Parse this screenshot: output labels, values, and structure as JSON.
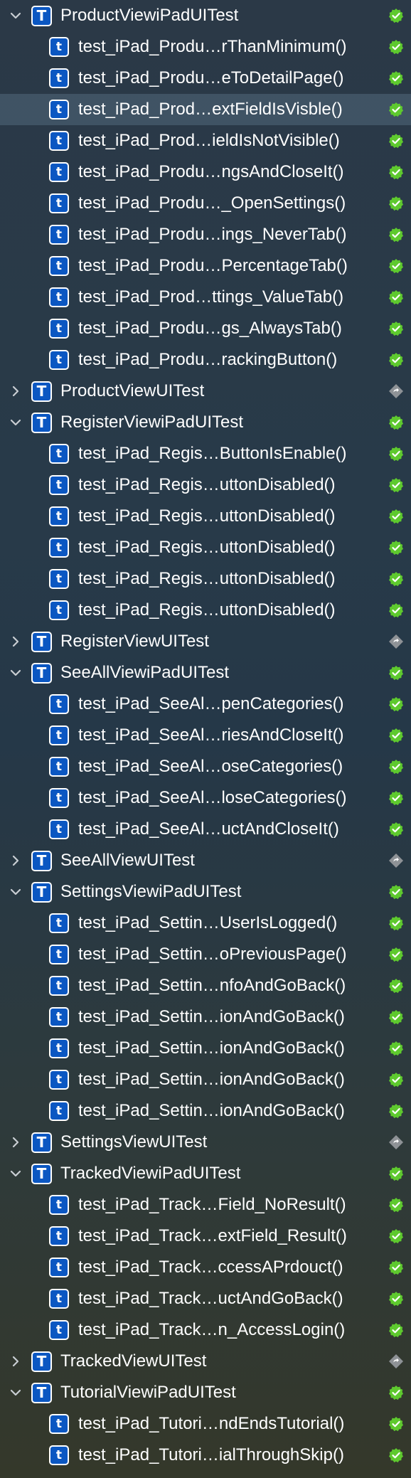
{
  "suites": [
    {
      "name": "ProductViewiPadUITest",
      "expanded": true,
      "status": "passed",
      "tests": [
        {
          "name": "test_iPad_Produ…rThanMinimum()",
          "status": "passed"
        },
        {
          "name": "test_iPad_Produ…eToDetailPage()",
          "status": "passed"
        },
        {
          "name": "test_iPad_Prod…extFieldIsVisble()",
          "status": "passed",
          "selected": true
        },
        {
          "name": "test_iPad_Prod…ieldIsNotVisible()",
          "status": "passed"
        },
        {
          "name": "test_iPad_Produ…ngsAndCloseIt()",
          "status": "passed"
        },
        {
          "name": "test_iPad_Produ…_OpenSettings()",
          "status": "passed"
        },
        {
          "name": "test_iPad_Produ…ings_NeverTab()",
          "status": "passed"
        },
        {
          "name": "test_iPad_Produ…PercentageTab()",
          "status": "passed"
        },
        {
          "name": "test_iPad_Prod…ttings_ValueTab()",
          "status": "passed"
        },
        {
          "name": "test_iPad_Produ…gs_AlwaysTab()",
          "status": "passed"
        },
        {
          "name": "test_iPad_Produ…rackingButton()",
          "status": "passed"
        }
      ]
    },
    {
      "name": "ProductViewUITest",
      "expanded": false,
      "status": "skipped",
      "tests": []
    },
    {
      "name": "RegisterViewiPadUITest",
      "expanded": true,
      "status": "passed",
      "tests": [
        {
          "name": "test_iPad_Regis…ButtonIsEnable()",
          "status": "passed"
        },
        {
          "name": "test_iPad_Regis…uttonDisabled()",
          "status": "passed"
        },
        {
          "name": "test_iPad_Regis…uttonDisabled()",
          "status": "passed"
        },
        {
          "name": "test_iPad_Regis…uttonDisabled()",
          "status": "passed"
        },
        {
          "name": "test_iPad_Regis…uttonDisabled()",
          "status": "passed"
        },
        {
          "name": "test_iPad_Regis…uttonDisabled()",
          "status": "passed"
        }
      ]
    },
    {
      "name": "RegisterViewUITest",
      "expanded": false,
      "status": "skipped",
      "tests": []
    },
    {
      "name": "SeeAllViewiPadUITest",
      "expanded": true,
      "status": "passed",
      "tests": [
        {
          "name": "test_iPad_SeeAl…penCategories()",
          "status": "passed"
        },
        {
          "name": "test_iPad_SeeAl…riesAndCloseIt()",
          "status": "passed"
        },
        {
          "name": "test_iPad_SeeAl…oseCategories()",
          "status": "passed"
        },
        {
          "name": "test_iPad_SeeAl…loseCategories()",
          "status": "passed"
        },
        {
          "name": "test_iPad_SeeAl…uctAndCloseIt()",
          "status": "passed"
        }
      ]
    },
    {
      "name": "SeeAllViewUITest",
      "expanded": false,
      "status": "skipped",
      "tests": []
    },
    {
      "name": "SettingsViewiPadUITest",
      "expanded": true,
      "status": "passed",
      "tests": [
        {
          "name": "test_iPad_Settin…UserIsLogged()",
          "status": "passed"
        },
        {
          "name": "test_iPad_Settin…oPreviousPage()",
          "status": "passed"
        },
        {
          "name": "test_iPad_Settin…nfoAndGoBack()",
          "status": "passed"
        },
        {
          "name": "test_iPad_Settin…ionAndGoBack()",
          "status": "passed"
        },
        {
          "name": "test_iPad_Settin…ionAndGoBack()",
          "status": "passed"
        },
        {
          "name": "test_iPad_Settin…ionAndGoBack()",
          "status": "passed"
        },
        {
          "name": "test_iPad_Settin…ionAndGoBack()",
          "status": "passed"
        }
      ]
    },
    {
      "name": "SettingsViewUITest",
      "expanded": false,
      "status": "skipped",
      "tests": []
    },
    {
      "name": "TrackedViewiPadUITest",
      "expanded": true,
      "status": "passed",
      "tests": [
        {
          "name": "test_iPad_Track…Field_NoResult()",
          "status": "passed"
        },
        {
          "name": "test_iPad_Track…extField_Result()",
          "status": "passed"
        },
        {
          "name": "test_iPad_Track…ccessAPrdouct()",
          "status": "passed"
        },
        {
          "name": "test_iPad_Track…uctAndGoBack()",
          "status": "passed"
        },
        {
          "name": "test_iPad_Track…n_AccessLogin()",
          "status": "passed"
        }
      ]
    },
    {
      "name": "TrackedViewUITest",
      "expanded": false,
      "status": "skipped",
      "tests": []
    },
    {
      "name": "TutorialViewiPadUITest",
      "expanded": true,
      "status": "passed",
      "tests": [
        {
          "name": "test_iPad_Tutori…ndEndsTutorial()",
          "status": "passed"
        },
        {
          "name": "test_iPad_Tutori…ialThroughSkip()",
          "status": "passed"
        }
      ]
    }
  ],
  "badges": {
    "suite": "T",
    "test": "t"
  },
  "colors": {
    "passed": "#5ec92e",
    "skipped": "#8e9296",
    "badge": "#0b57c2",
    "selected_row": "#46576a"
  }
}
